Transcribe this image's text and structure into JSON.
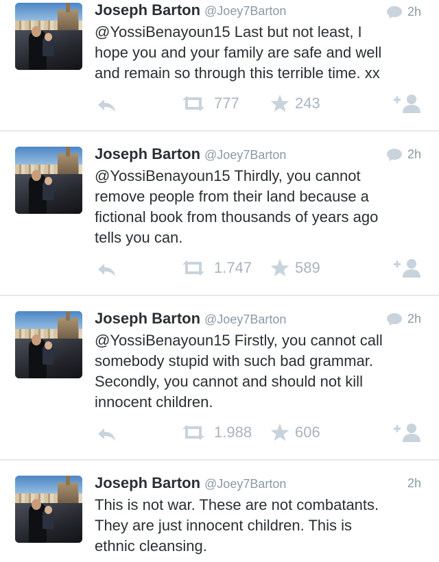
{
  "feed": {
    "tweets": [
      {
        "name": "Joseph Barton",
        "handle": "@Joey7Barton",
        "time": "2h",
        "is_reply": true,
        "text": "@YossiBenayoun15 Last but not least, I\nhope you and your family are safe and well\nand remain so through this terrible time. xx",
        "retweets": "777",
        "favorites": "243"
      },
      {
        "name": "Joseph Barton",
        "handle": "@Joey7Barton",
        "time": "2h",
        "is_reply": true,
        "text": "@YossiBenayoun15 Thirdly, you cannot\nremove people from their land because a\nfictional book from thousands of years ago\ntells you can.",
        "retweets": "1.747",
        "favorites": "589"
      },
      {
        "name": "Joseph Barton",
        "handle": "@Joey7Barton",
        "time": "2h",
        "is_reply": true,
        "text": "@YossiBenayoun15 Firstly, you cannot call\nsomebody stupid with such bad grammar.\nSecondly, you cannot and should not kill\ninnocent children.",
        "retweets": "1.988",
        "favorites": "606"
      },
      {
        "name": "Joseph Barton",
        "handle": "@Joey7Barton",
        "time": "2h",
        "is_reply": false,
        "text": "This is not war. These are not combatants.\nThey are just innocent children. This is\nethnic cleansing."
      }
    ]
  },
  "icons": {
    "reply": "reply-arrow-icon",
    "retweet": "retweet-icon",
    "favorite": "star-icon",
    "follow": "follow-user-icon",
    "conversation": "speech-bubble-icon"
  },
  "colors": {
    "text": "#292f33",
    "muted": "#8899a6",
    "icon": "#c8d3dc",
    "divider": "#e6e8ea"
  }
}
